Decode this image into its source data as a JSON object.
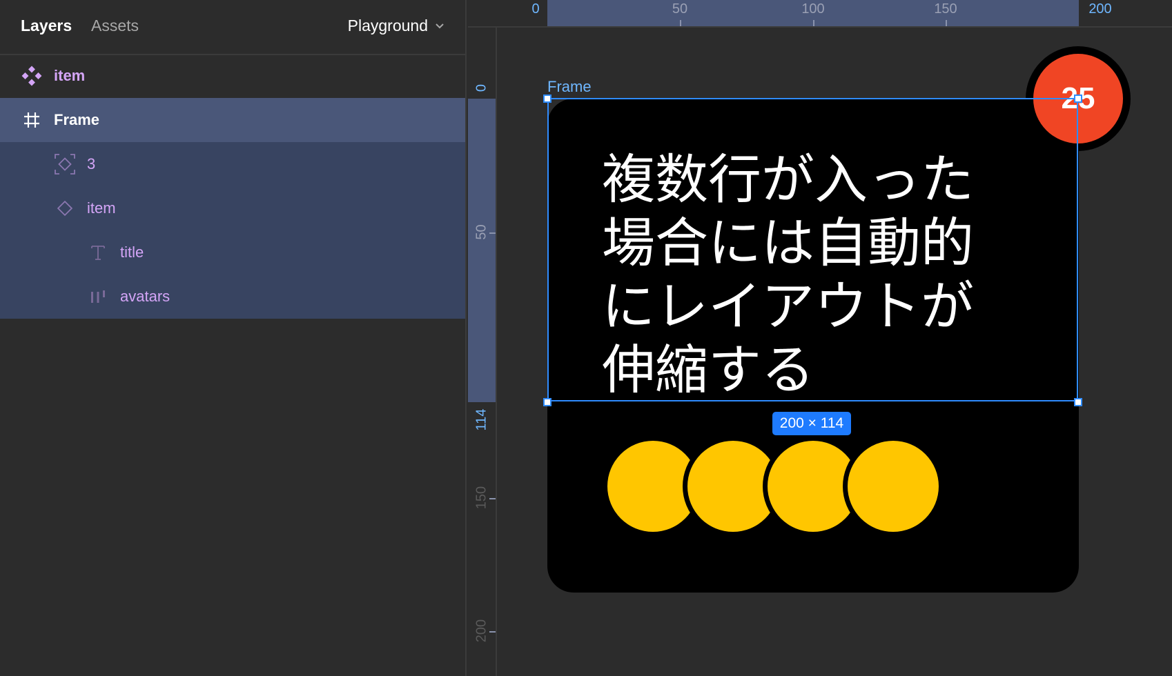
{
  "panel": {
    "tabs": {
      "layers": "Layers",
      "assets": "Assets"
    },
    "page_selector": "Playground",
    "layers": [
      {
        "name": "item",
        "icon": "component-icon"
      },
      {
        "name": "Frame",
        "icon": "frame-icon"
      },
      {
        "name": "3",
        "icon": "instance-icon"
      },
      {
        "name": "item",
        "icon": "instance-diamond-icon"
      },
      {
        "name": "title",
        "icon": "text-icon"
      },
      {
        "name": "avatars",
        "icon": "auto-layout-icon"
      }
    ]
  },
  "canvas": {
    "ruler_top": [
      "0",
      "50",
      "100",
      "150",
      "200"
    ],
    "ruler_left": [
      "0",
      "50",
      "114",
      "150",
      "200"
    ],
    "frame_label": "Frame",
    "card_title": "複数行が入った場合には自動的にレイアウトが伸縮する",
    "size_badge": "200 × 114",
    "notification_count": "25",
    "avatar_count": 4
  },
  "colors": {
    "selection": "#2f8cff",
    "component_purple": "#d4a5f7",
    "avatar_yellow": "#ffc600",
    "badge_red": "#f04524",
    "highlight_bg": "#4a5779"
  }
}
